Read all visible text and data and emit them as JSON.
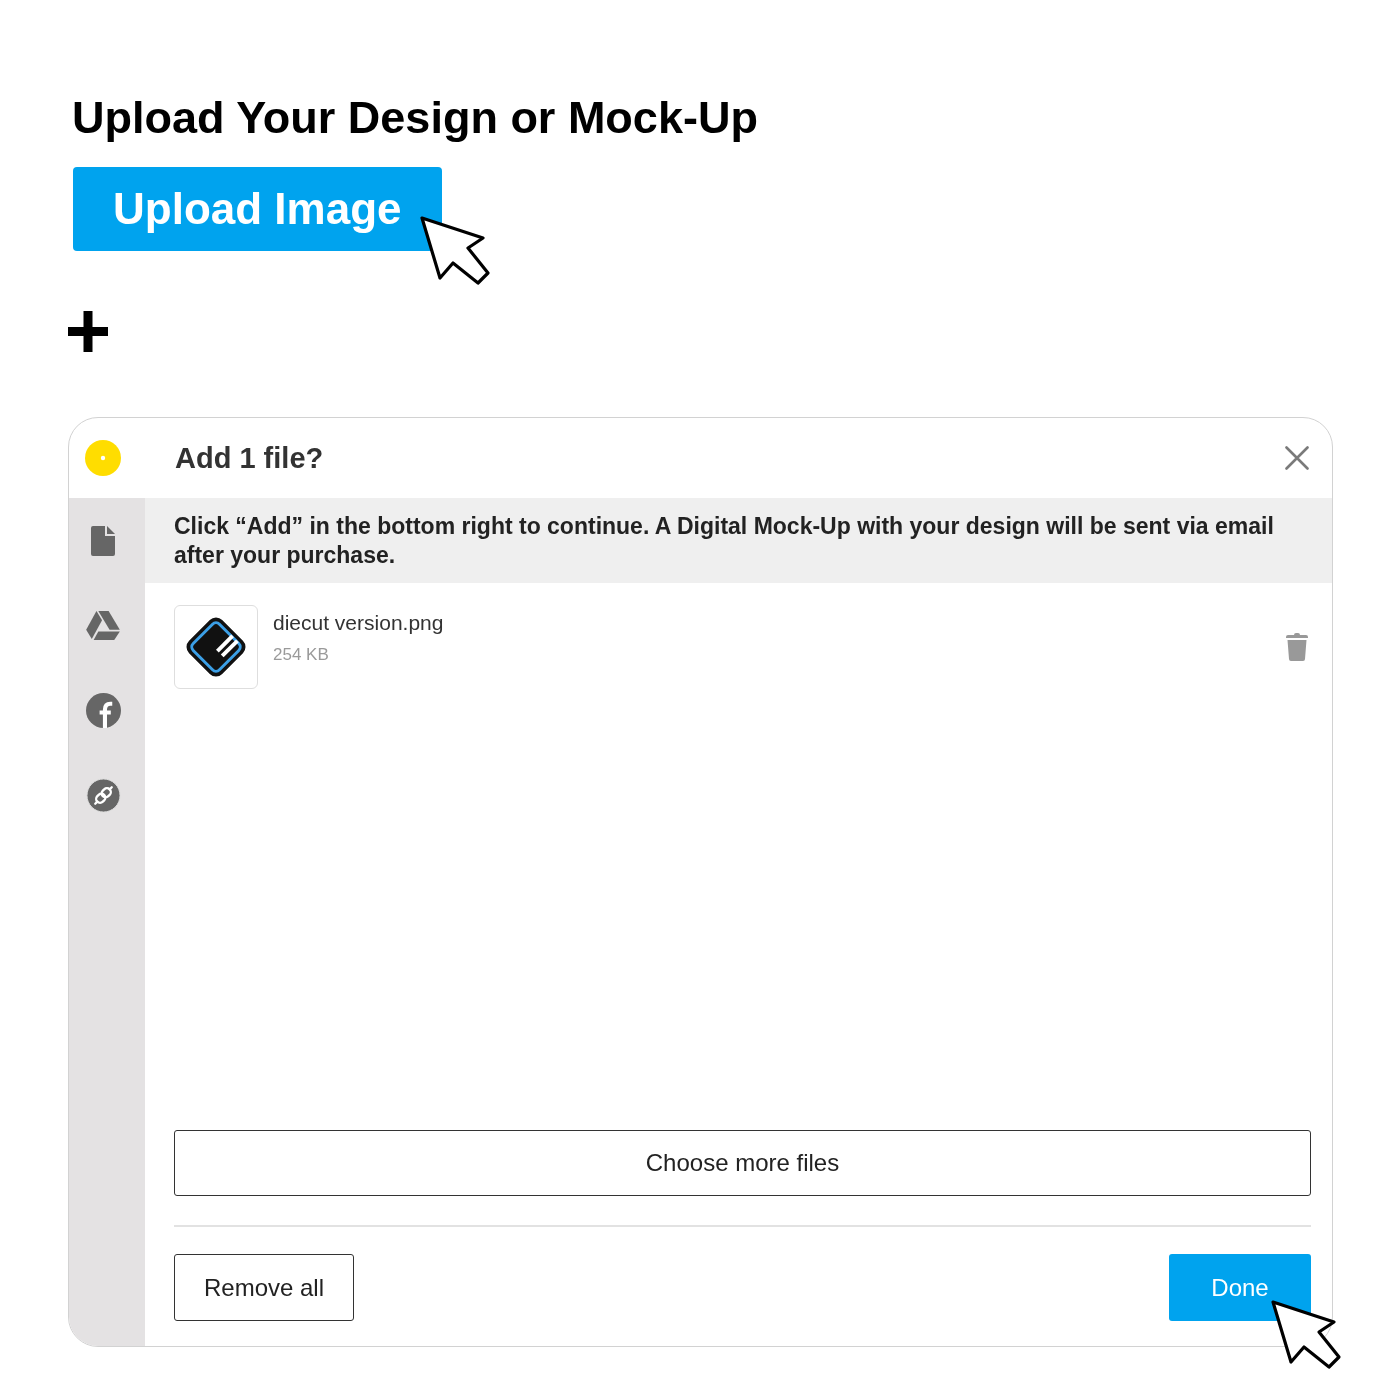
{
  "heading": "Upload Your Design or Mock-Up",
  "upload_button": {
    "label": "Upload Image"
  },
  "dialog": {
    "title": "Add 1 file?",
    "notice": "Click “Add” in the bottom right to continue. A Digital Mock-Up with your design will be sent via email after your purchase.",
    "files": [
      {
        "name": "diecut version.png",
        "size": "254 KB"
      }
    ],
    "choose_more_button": "Choose more files",
    "remove_all_button": "Remove all",
    "done_button": "Done"
  }
}
